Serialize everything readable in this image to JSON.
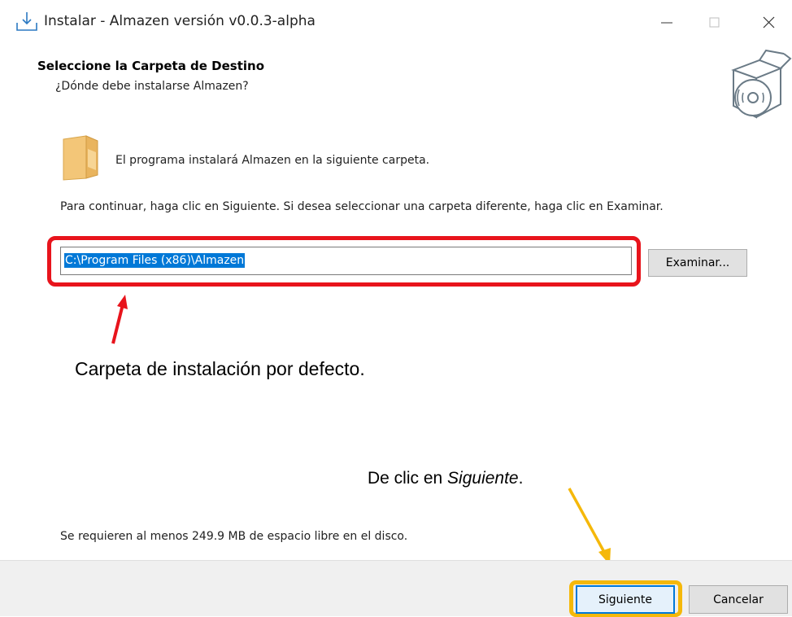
{
  "window": {
    "title": "Instalar - Almazen versión v0.0.3-alpha",
    "icons": {
      "app": "download-icon",
      "minimize": "minimize-icon",
      "maximize": "maximize-icon",
      "close": "close-icon"
    }
  },
  "header": {
    "heading": "Seleccione la Carpeta de Destino",
    "subheading": "¿Dónde debe instalarse Almazen?",
    "icon": "installer-box-disc-icon"
  },
  "body": {
    "folder_icon": "folder-icon",
    "folder_message": "El programa instalará Almazen en la siguiente carpeta.",
    "instruction": "Para continuar, haga clic en Siguiente. Si desea seleccionar una carpeta diferente, haga clic en Examinar.",
    "path_value": "C:\\Program Files (x86)\\Almazen",
    "browse_label": "Examinar...",
    "space_requirement": "Se requieren al menos 249.9 MB de espacio libre en el disco."
  },
  "annotations": {
    "folder_caption": "Carpeta de instalación por defecto.",
    "next_caption_prefix": "De clic en ",
    "next_caption_emphasis": "Siguiente",
    "next_caption_suffix": ".",
    "colors": {
      "red": "#e8141c",
      "yellow": "#f5b80a"
    }
  },
  "footer": {
    "next_label": "Siguiente",
    "cancel_label": "Cancelar"
  }
}
